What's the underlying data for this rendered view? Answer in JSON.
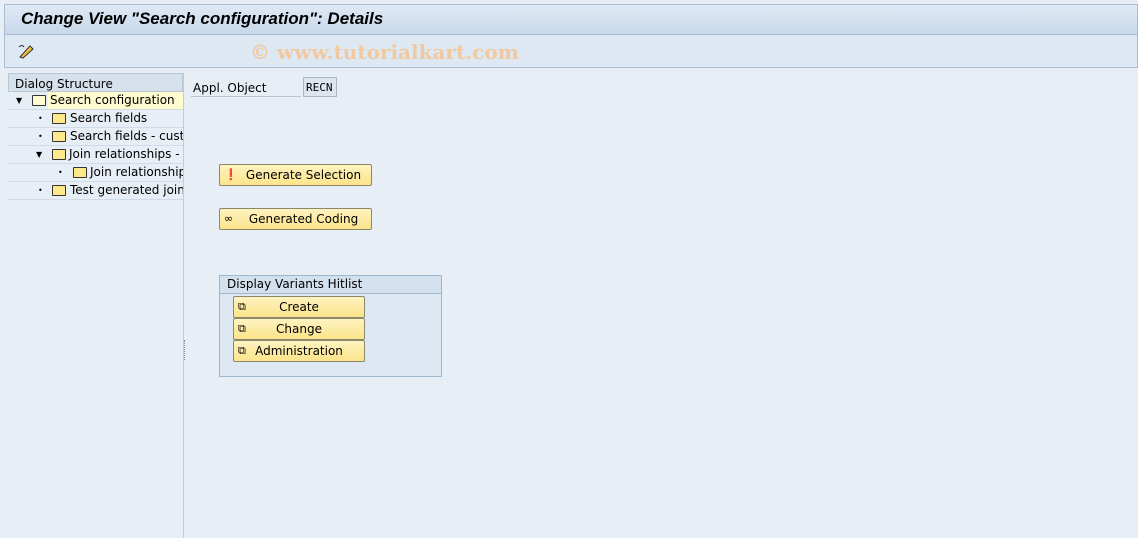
{
  "window": {
    "title": "Change View \"Search configuration\": Details",
    "watermark": "© www.tutorialkart.com"
  },
  "toolbar": {
    "icons": [
      "display-change-icon"
    ]
  },
  "dialog_structure": {
    "header": "Dialog Structure",
    "nodes": [
      {
        "label": "Search configuration",
        "level": 0,
        "expanded": true,
        "selected": true
      },
      {
        "label": "Search fields",
        "level": 1
      },
      {
        "label": "Search fields - custor",
        "level": 1
      },
      {
        "label": "Join relationships - ta",
        "level": 1,
        "expanded": true
      },
      {
        "label": "Join relationships",
        "level": 2
      },
      {
        "label": "Test generated joins",
        "level": 1
      }
    ]
  },
  "main": {
    "appl_object_label": "Appl. Object",
    "appl_object_value": "RECN",
    "generate_selection": "Generate Selection",
    "generated_coding": "Generated Coding",
    "hitlist": {
      "title": "Display Variants Hitlist",
      "create": "Create",
      "change": "Change",
      "administration": "Administration"
    }
  }
}
